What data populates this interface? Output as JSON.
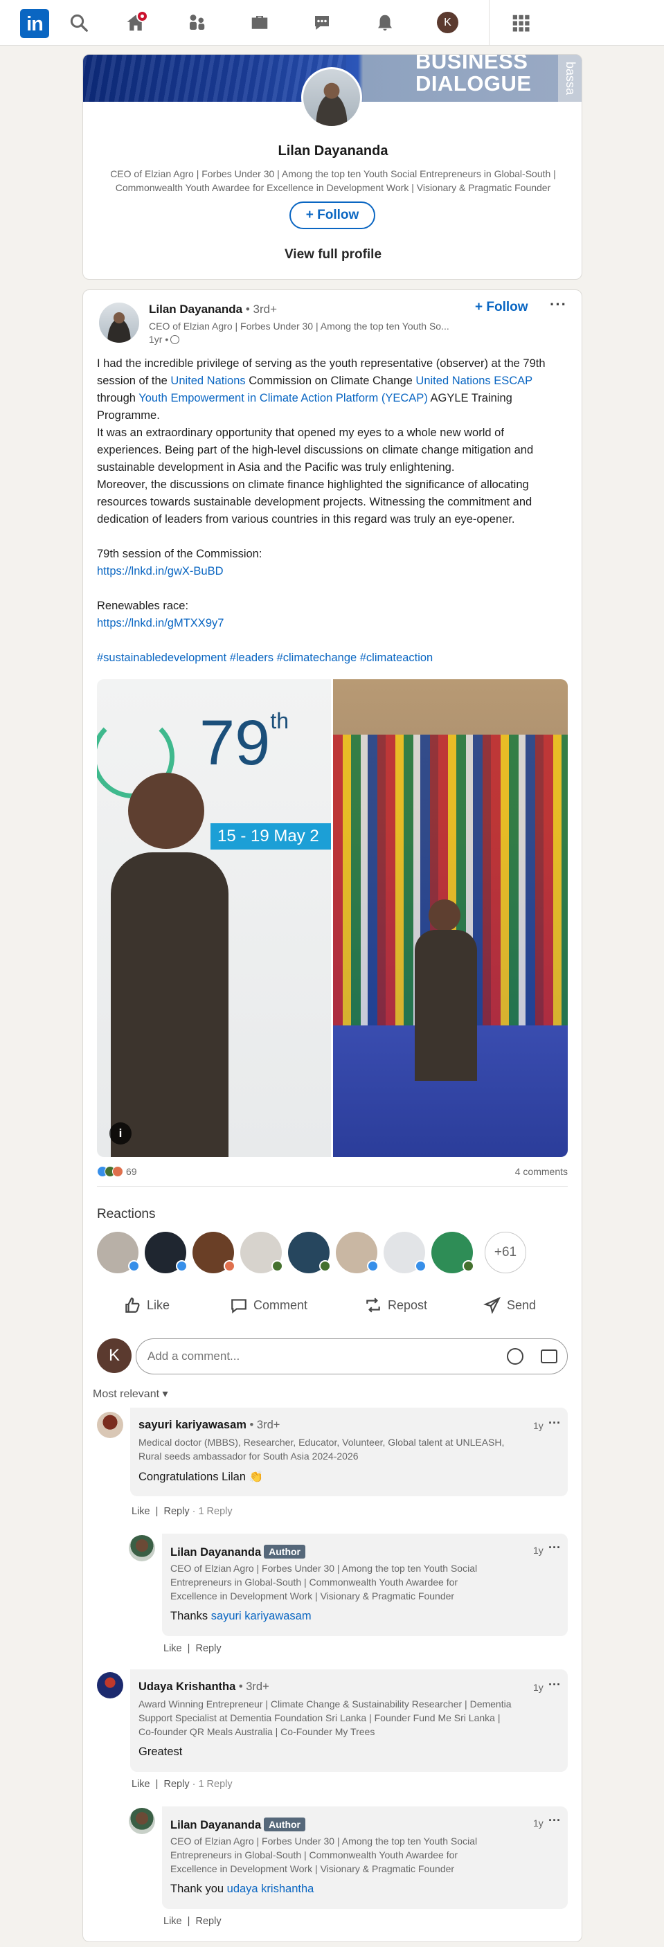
{
  "nav": {
    "logo": "in",
    "avatar_letter": "K",
    "icons": [
      "search-icon",
      "home-icon",
      "my-network-icon",
      "jobs-icon",
      "messaging-icon",
      "notifications-icon",
      "work-grid-icon"
    ]
  },
  "profile": {
    "banner_text_1": "BUSINESS",
    "banner_text_2": "DIALOGUE",
    "banner_tab": "bassa",
    "name": "Lilan Dayananda",
    "headline": "CEO of Elzian Agro | Forbes Under 30 | Among the top ten Youth Social Entrepreneurs in Global-South | Commonwealth Youth Awardee for Excellence in Development Work | Visionary & Pragmatic Founder",
    "follow_label": "+ Follow",
    "view_profile_label": "View full profile"
  },
  "post": {
    "author": "Lilan Dayananda",
    "degree": "• 3rd+",
    "author_headline": "CEO of Elzian Agro | Forbes Under 30 | Among the top ten Youth So...",
    "time": "1yr •",
    "follow_label": "+ Follow",
    "more": "···",
    "para1_a": "I had the incredible privilege of serving as the youth representative (observer) at the 79th session of the ",
    "link_un": "United Nations",
    "para1_b": " Commission on Climate Change ",
    "link_escap": "United Nations ESCAP",
    "para1_c": " through ",
    "link_yecap": "Youth Empowerment in Climate Action Platform (YECAP)",
    "para1_d": " AGYLE Training Programme.",
    "para2": "It was an extraordinary opportunity that opened my eyes to a whole new world of experiences. Being part of the high-level discussions on climate change mitigation and sustainable development in Asia and the Pacific was truly enlightening.",
    "para3": "Moreover, the discussions on climate finance highlighted the significance of allocating resources towards sustainable development projects. Witnessing the commitment and dedication of leaders from various countries in this regard was truly an eye-opener.",
    "session_label": "79th session of the Commission:",
    "session_link": "https://lnkd.in/gwX-BuBD",
    "renewables_label": "Renewables race:",
    "renewables_link": "https://lnkd.in/gMTXX9y7",
    "hashtags": "#sustainabledevelopment #leaders #climatechange #climateaction",
    "image_79": "79",
    "image_th": "th",
    "image_dates": "15 - 19 May 2",
    "reaction_count": "69",
    "comments_count": "4 comments",
    "reactions_title": "Reactions",
    "more_reactors": "+61",
    "actions": {
      "like": "Like",
      "comment": "Comment",
      "repost": "Repost",
      "send": "Send"
    },
    "add_comment_placeholder": "Add a comment...",
    "me_letter": "K",
    "sort_label": "Most relevant ▾"
  },
  "comments": [
    {
      "name": "sayuri kariyawasam",
      "degree": "• 3rd+",
      "headline": "Medical doctor (MBBS), Researcher, Educator, Volunteer, Global talent at UNLEASH, Rural seeds ambassador for South Asia 2024-2026",
      "text": "Congratulations Lilan 👏",
      "time": "1y",
      "like": "Like",
      "reply": "Reply",
      "reply_count": "· 1 Reply"
    },
    {
      "name": "Lilan Dayananda",
      "badge": "Author",
      "headline": "CEO of Elzian Agro | Forbes Under 30 | Among the top ten Youth Social Entrepreneurs in Global-South | Commonwealth Youth Awardee for Excellence in Development Work | Visionary & Pragmatic Founder",
      "text_a": "Thanks ",
      "mention": "sayuri kariyawasam",
      "time": "1y",
      "like": "Like",
      "reply": "Reply"
    },
    {
      "name": "Udaya Krishantha",
      "degree": "• 3rd+",
      "headline": "Award Winning Entrepreneur | Climate Change & Sustainability Researcher | Dementia Support Specialist at Dementia Foundation Sri Lanka | Founder Fund Me Sri Lanka | Co-founder QR Meals Australia | Co-Founder My Trees",
      "text": "Greatest",
      "time": "1y",
      "like": "Like",
      "reply": "Reply",
      "reply_count": "· 1 Reply"
    },
    {
      "name": "Lilan Dayananda",
      "badge": "Author",
      "headline": "CEO of Elzian Agro | Forbes Under 30 | Among the top ten Youth Social Entrepreneurs in Global-South | Commonwealth Youth Awardee for Excellence in Development Work | Visionary & Pragmatic Founder",
      "text_a": "Thank you ",
      "mention": "udaya krishantha",
      "time": "1y",
      "like": "Like",
      "reply": "Reply"
    }
  ],
  "colors": {
    "brand": "#0a66c2",
    "notification": "#cb112d",
    "author_badge": "#56687a"
  }
}
